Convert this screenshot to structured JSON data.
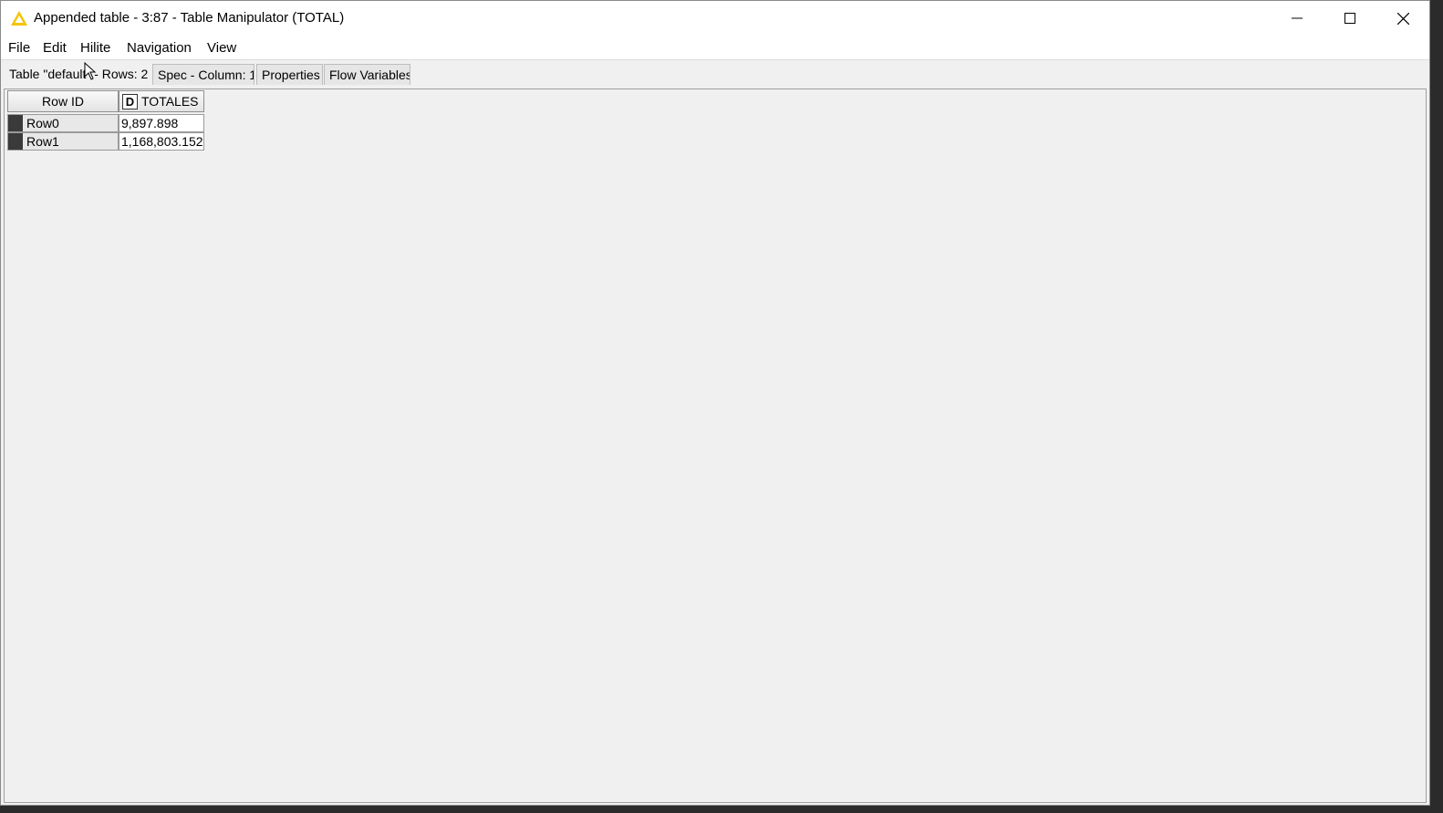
{
  "window": {
    "title": "Appended table - 3:87 - Table Manipulator (TOTAL)",
    "icon": "warning-triangle-icon",
    "icon_color": "#f5c400"
  },
  "menubar": {
    "items": [
      "File",
      "Edit",
      "Hilite",
      "Navigation",
      "View"
    ]
  },
  "tabs": [
    {
      "label": "Table \"default\" - Rows: 2",
      "active": true
    },
    {
      "label": "Spec - Column: 1",
      "active": false
    },
    {
      "label": "Properties",
      "active": false
    },
    {
      "label": "Flow Variables",
      "active": false
    }
  ],
  "table": {
    "row_id_header": "Row ID",
    "columns": [
      {
        "type_badge": "D",
        "name": "TOTALES"
      }
    ],
    "rows": [
      {
        "id": "Row0",
        "values": [
          "9,897.898"
        ]
      },
      {
        "id": "Row1",
        "values": [
          "1,168,803.152"
        ]
      }
    ]
  }
}
